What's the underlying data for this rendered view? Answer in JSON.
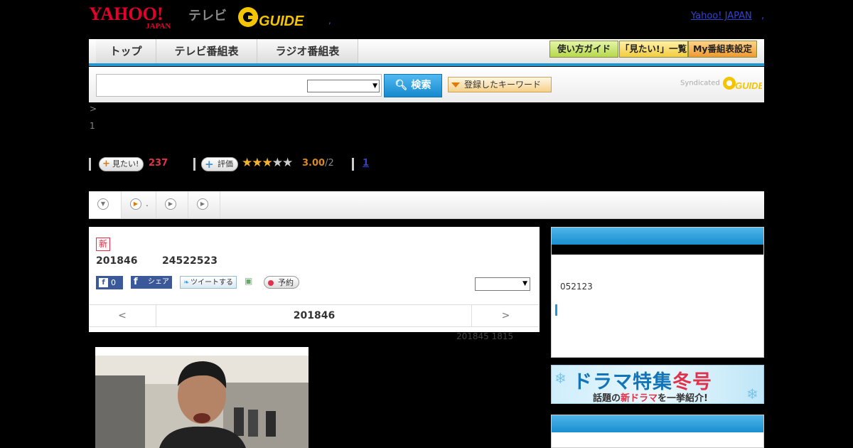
{
  "header": {
    "yahoo_logo_text": "YAHOO!",
    "japan_text": "JAPAN",
    "tv_label": "テレビ",
    "gguide_logo_text": "GUIDE",
    "separator_dot": ",",
    "yahoo_japan_link": "Yahoo! JAPAN",
    "trailing_dot": ","
  },
  "nav": {
    "tabs": [
      {
        "label": "トップ"
      },
      {
        "label": "テレビ番組表"
      },
      {
        "label": "ラジオ番組表"
      }
    ],
    "buttons": [
      {
        "label": "使い方ガイド",
        "color": "#c8e66a"
      },
      {
        "label": "「見たい!」一覧",
        "color": "#f5d560"
      },
      {
        "label": "My番組表設定",
        "color": "#f3a743"
      }
    ]
  },
  "search": {
    "input_value": "",
    "select_value": "",
    "button_label": "検索",
    "keyword_button_label": "登録したキーワード",
    "syndicated_label": "Syndicated",
    "syndicated_logo": "GUIDE"
  },
  "breadcrumb": ">",
  "page_number": "1",
  "ratings": {
    "want_label": "見たい!",
    "want_count": "237",
    "rate_label": "評価",
    "stars_filled": 3,
    "stars_total": 5,
    "score": "3.00",
    "score_suffix": "/2",
    "link_count": "1"
  },
  "strip_tabs": [
    {
      "icon": "chevron-down-icon",
      "text": ""
    },
    {
      "icon": "play-icon",
      "text": "."
    },
    {
      "icon": "play-icon",
      "text": ""
    },
    {
      "icon": "play-icon",
      "text": ""
    }
  ],
  "program": {
    "new_badge": "新",
    "date": "201846",
    "time": "24522523",
    "fb_count": "0",
    "fb_share_label": "シェア",
    "tweet_label": "ツイートする",
    "reserve_label": "予約",
    "select_value": "",
    "pager_prev": "<",
    "pager_next": ">",
    "pager_date": "201846",
    "air_info": "201845  1815"
  },
  "sidebar": {
    "box1_text": "052123",
    "banner_title_main": "ドラマ特集",
    "banner_title_accent": "冬号",
    "banner_sub_prefix": "話題の",
    "banner_sub_accent": "新ドラマ",
    "banner_sub_suffix": "を一挙紹介!"
  },
  "colors": {
    "accent_blue": "#1a9ad6",
    "red": "#e2324b",
    "star_gold": "#f3b32a"
  }
}
